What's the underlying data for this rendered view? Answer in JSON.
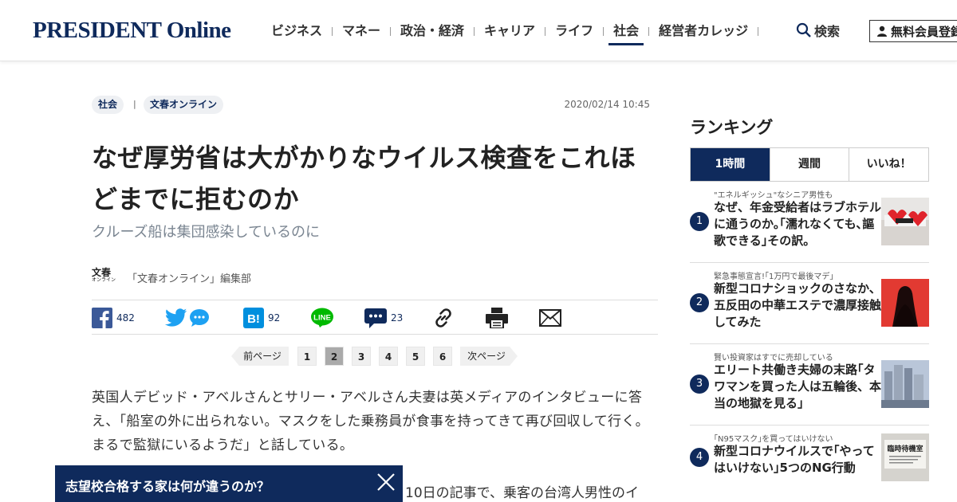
{
  "header": {
    "logo": "PRESIDENT Online",
    "nav": [
      "ビジネス",
      "マネー",
      "政治・経済",
      "キャリア",
      "ライフ",
      "社会",
      "経営者カレッジ"
    ],
    "active_nav": "社会",
    "search_label": "検索",
    "member_label": "無料会員登録"
  },
  "article": {
    "tags": [
      "社会",
      "文春オンライン"
    ],
    "tag_separator": "|",
    "date": "2020/02/14 10:45",
    "title": "なぜ厚労省は大がかりなウイルス検査をこれほどまでに拒むのか",
    "subtitle": "クルーズ船は集団感染しているのに",
    "author_logo_main": "文春",
    "author_logo_sub": "オンライン",
    "author": "「文春オンライン」編集部",
    "share": {
      "facebook_count": "482",
      "hatena_count": "92",
      "hatena_label": "B!",
      "line_label": "LINE",
      "comment_count": "23"
    },
    "pager": {
      "prev": "前ページ",
      "pages": [
        "1",
        "2",
        "3",
        "4",
        "5",
        "6"
      ],
      "current": "2",
      "next": "次ページ"
    },
    "body": "英国人デビッド・アベルさんとサリー・アベルさん夫妻は英メディアのインタビューに答え、「船室の外に出られない。マスクをした乗務員が食事を持ってきて再び回収して行く。まるで監獄にいるようだ」と話している。",
    "body_partial": "10日の記事で、乗客の台湾人男性のイ"
  },
  "banner": {
    "text": "志望校合格する家は何が違うのか？"
  },
  "ranking": {
    "title": "ランキング",
    "tabs": [
      "1時間",
      "週間",
      "いいね！"
    ],
    "active_tab": "1時間",
    "items": [
      {
        "rank": "1",
        "kicker": "\"エネルギッシュ\"なシニア男性も",
        "headline": "なぜ、年金受給者はラブホテルに通うのか｡｢濡れなくても､謳歌できる｣その訳。",
        "thumb": "hotel-photo"
      },
      {
        "rank": "2",
        "kicker": "緊急事態宣言!｢1万円で最後マデ｣",
        "headline": "新型コロナショックのさなか、五反田の中華エステで濃厚接触してみた",
        "thumb": "silhouette-photo"
      },
      {
        "rank": "3",
        "kicker": "賢い投資家はすでに売却している",
        "headline": "エリート共働き夫婦の末路｢タワマンを買った人は五輪後、本当の地獄を見る｣",
        "thumb": "tower-photo"
      },
      {
        "rank": "4",
        "kicker": "｢N95マスク｣を買ってはいけない",
        "headline": "新型コロナウイルスで｢やってはいけない｣5つのNG行動",
        "thumb": "waiting-room-photo",
        "thumb_text": "臨時待機室"
      }
    ]
  },
  "colors": {
    "brand_navy": "#0f2a5c",
    "facebook": "#3b5998",
    "twitter": "#1da1f2",
    "hatena": "#008fde",
    "line": "#00b900"
  }
}
